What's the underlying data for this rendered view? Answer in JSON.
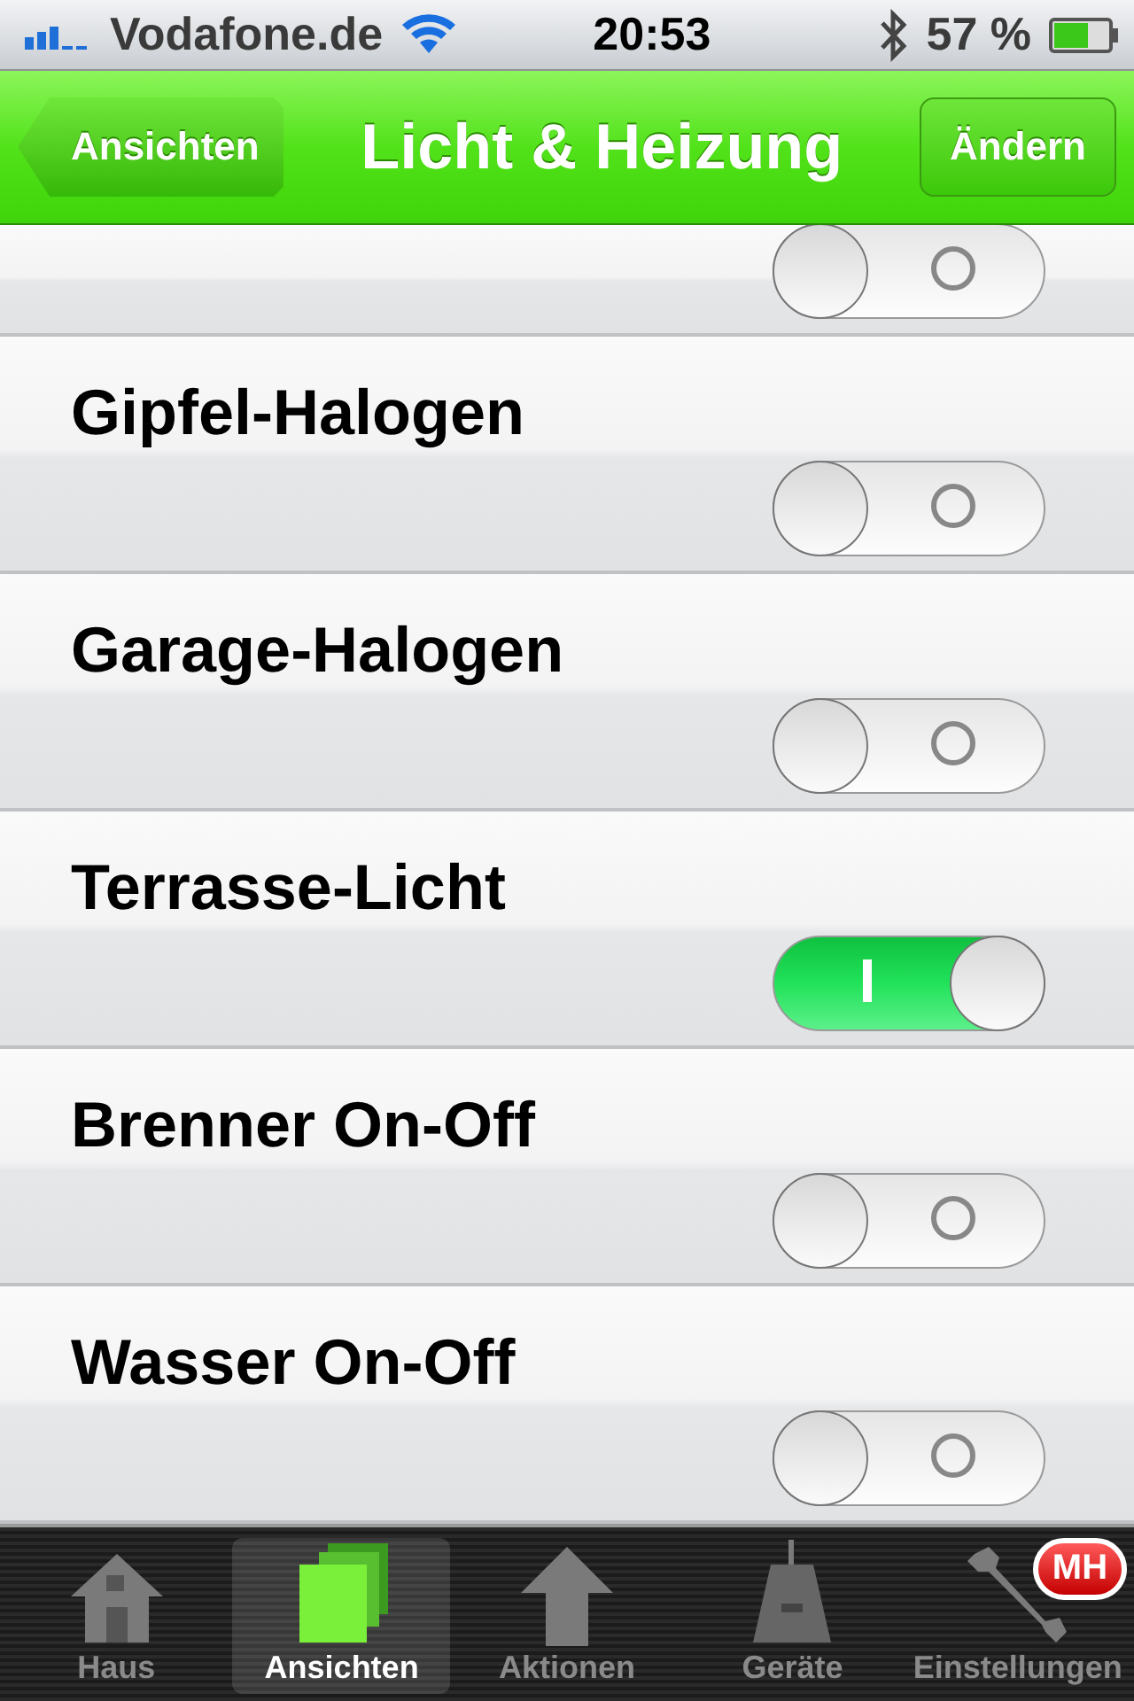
{
  "status_bar": {
    "carrier": "Vodafone.de",
    "time": "20:53",
    "battery": "57 %"
  },
  "nav_bar": {
    "back": "Ansichten",
    "title": "Licht & Heizung",
    "action": "Ändern"
  },
  "rows": [
    {
      "on": false
    },
    {
      "label": "Gipfel-Halogen",
      "on": false
    },
    {
      "label": "Garage-Halogen",
      "on": false
    },
    {
      "label": "Terrasse-Licht",
      "on": true
    },
    {
      "label": "Brenner On-Off",
      "on": false
    },
    {
      "label": "Wasser On-Off",
      "on": false
    }
  ],
  "tab_bar": [
    {
      "label": "Haus",
      "kind": "house",
      "selected": false
    },
    {
      "label": "Ansichten",
      "kind": "views",
      "selected": true
    },
    {
      "label": "Aktionen",
      "kind": "arrow",
      "selected": false
    },
    {
      "label": "Geräte",
      "kind": "device",
      "selected": false
    },
    {
      "label": "Einstellungen",
      "kind": "wrench",
      "selected": false,
      "badge": "MH"
    }
  ]
}
